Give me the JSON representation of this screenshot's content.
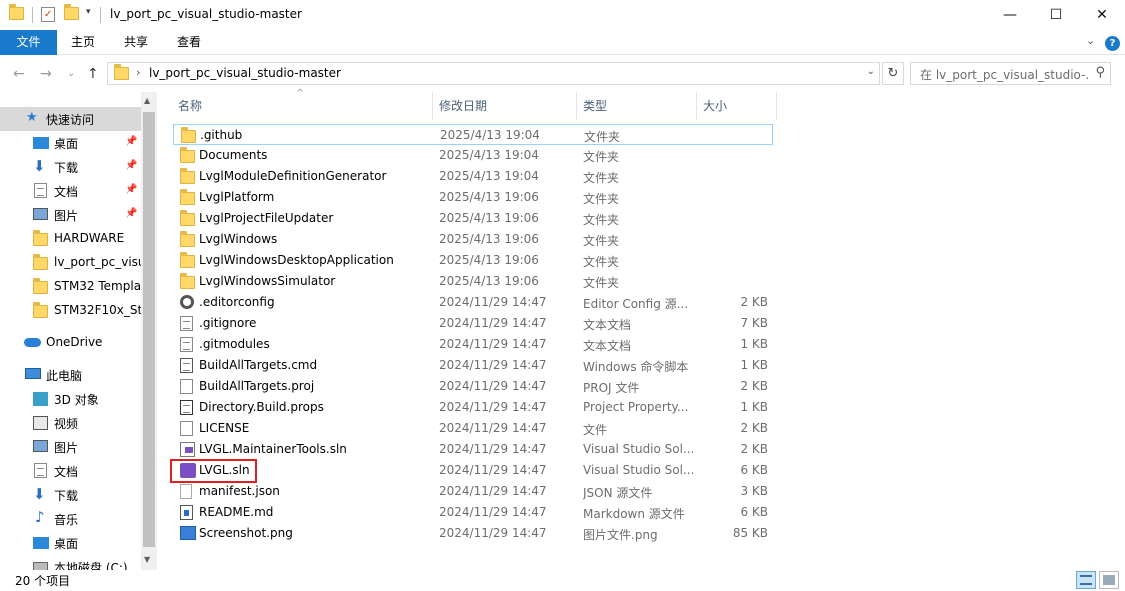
{
  "window": {
    "title": "lv_port_pc_visual_studio-master",
    "min": "—",
    "max": "☐",
    "close": "✕"
  },
  "ribbon": {
    "tabs": [
      "文件",
      "主页",
      "共享",
      "查看"
    ],
    "expand_glyph": "⌄",
    "help": "?"
  },
  "nav": {
    "back": "←",
    "forward": "→",
    "recent": "⌄",
    "up": "↑",
    "address_chevron": "›",
    "address_path": "lv_port_pc_visual_studio-master",
    "address_dropdown": "⌄",
    "refresh": "↻",
    "search_placeholder": "在 lv_port_pc_visual_studio-...",
    "search_icon": "⚲"
  },
  "sidebar": {
    "items": [
      {
        "label": "快速访问",
        "icon": "star-icon",
        "pinned": false
      },
      {
        "label": "桌面",
        "icon": "desktop-icon",
        "pinned": true
      },
      {
        "label": "下载",
        "icon": "download-icon",
        "pinned": true
      },
      {
        "label": "文档",
        "icon": "document-icon",
        "pinned": true
      },
      {
        "label": "图片",
        "icon": "pictures-icon",
        "pinned": true
      },
      {
        "label": "HARDWARE",
        "icon": "folder-icon",
        "pinned": false
      },
      {
        "label": "lv_port_pc_visu",
        "icon": "folder-icon",
        "pinned": false
      },
      {
        "label": "STM32 Templa",
        "icon": "folder-icon",
        "pinned": false
      },
      {
        "label": "STM32F10x_Std",
        "icon": "folder-icon",
        "pinned": false
      },
      {
        "label": "OneDrive",
        "icon": "cloud-icon",
        "pinned": false
      },
      {
        "label": "此电脑",
        "icon": "computer-icon",
        "pinned": false
      },
      {
        "label": "3D 对象",
        "icon": "cube-icon",
        "pinned": false
      },
      {
        "label": "视频",
        "icon": "video-icon",
        "pinned": false
      },
      {
        "label": "图片",
        "icon": "pictures-icon",
        "pinned": false
      },
      {
        "label": "文档",
        "icon": "document-icon",
        "pinned": false
      },
      {
        "label": "下载",
        "icon": "download-icon",
        "pinned": false
      },
      {
        "label": "音乐",
        "icon": "music-icon",
        "pinned": false
      },
      {
        "label": "桌面",
        "icon": "desktop-icon",
        "pinned": false
      },
      {
        "label": "本地磁盘 (C:)",
        "icon": "drive-icon",
        "pinned": false
      }
    ]
  },
  "list": {
    "columns": {
      "name": "名称",
      "date": "修改日期",
      "type": "类型",
      "size": "大小"
    },
    "sort_indicator": "^",
    "rows": [
      {
        "name": ".github",
        "date": "2025/4/13 19:04",
        "type": "文件夹",
        "size": "",
        "icon": "folder-icon"
      },
      {
        "name": "Documents",
        "date": "2025/4/13 19:04",
        "type": "文件夹",
        "size": "",
        "icon": "folder-icon"
      },
      {
        "name": "LvglModuleDefinitionGenerator",
        "date": "2025/4/13 19:04",
        "type": "文件夹",
        "size": "",
        "icon": "folder-icon"
      },
      {
        "name": "LvglPlatform",
        "date": "2025/4/13 19:06",
        "type": "文件夹",
        "size": "",
        "icon": "folder-icon"
      },
      {
        "name": "LvglProjectFileUpdater",
        "date": "2025/4/13 19:06",
        "type": "文件夹",
        "size": "",
        "icon": "folder-icon"
      },
      {
        "name": "LvglWindows",
        "date": "2025/4/13 19:06",
        "type": "文件夹",
        "size": "",
        "icon": "folder-icon"
      },
      {
        "name": "LvglWindowsDesktopApplication",
        "date": "2025/4/13 19:06",
        "type": "文件夹",
        "size": "",
        "icon": "folder-icon"
      },
      {
        "name": "LvglWindowsSimulator",
        "date": "2025/4/13 19:06",
        "type": "文件夹",
        "size": "",
        "icon": "folder-icon"
      },
      {
        "name": ".editorconfig",
        "date": "2024/11/29 14:47",
        "type": "Editor Config 源...",
        "size": "2 KB",
        "icon": "gear-file-icon"
      },
      {
        "name": ".gitignore",
        "date": "2024/11/29 14:47",
        "type": "文本文档",
        "size": "7 KB",
        "icon": "text-file-icon"
      },
      {
        "name": ".gitmodules",
        "date": "2024/11/29 14:47",
        "type": "文本文档",
        "size": "1 KB",
        "icon": "text-file-icon"
      },
      {
        "name": "BuildAllTargets.cmd",
        "date": "2024/11/29 14:47",
        "type": "Windows 命令脚本",
        "size": "1 KB",
        "icon": "cmd-file-icon"
      },
      {
        "name": "BuildAllTargets.proj",
        "date": "2024/11/29 14:47",
        "type": "PROJ 文件",
        "size": "2 KB",
        "icon": "blank-file-icon"
      },
      {
        "name": "Directory.Build.props",
        "date": "2024/11/29 14:47",
        "type": "Project Property...",
        "size": "1 KB",
        "icon": "props-file-icon"
      },
      {
        "name": "LICENSE",
        "date": "2024/11/29 14:47",
        "type": "文件",
        "size": "2 KB",
        "icon": "blank-file-icon"
      },
      {
        "name": "LVGL.MaintainerTools.sln",
        "date": "2024/11/29 14:47",
        "type": "Visual Studio Sol...",
        "size": "2 KB",
        "icon": "sln-file-icon"
      },
      {
        "name": "LVGL.sln",
        "date": "2024/11/29 14:47",
        "type": "Visual Studio Sol...",
        "size": "6 KB",
        "icon": "vs-sln-icon"
      },
      {
        "name": "manifest.json",
        "date": "2024/11/29 14:47",
        "type": "JSON 源文件",
        "size": "3 KB",
        "icon": "json-file-icon"
      },
      {
        "name": "README.md",
        "date": "2024/11/29 14:47",
        "type": "Markdown 源文件",
        "size": "6 KB",
        "icon": "markdown-file-icon"
      },
      {
        "name": "Screenshot.png",
        "date": "2024/11/29 14:47",
        "type": "图片文件.png",
        "size": "85 KB",
        "icon": "image-file-icon"
      }
    ]
  },
  "status": {
    "count": "20 个项目"
  }
}
